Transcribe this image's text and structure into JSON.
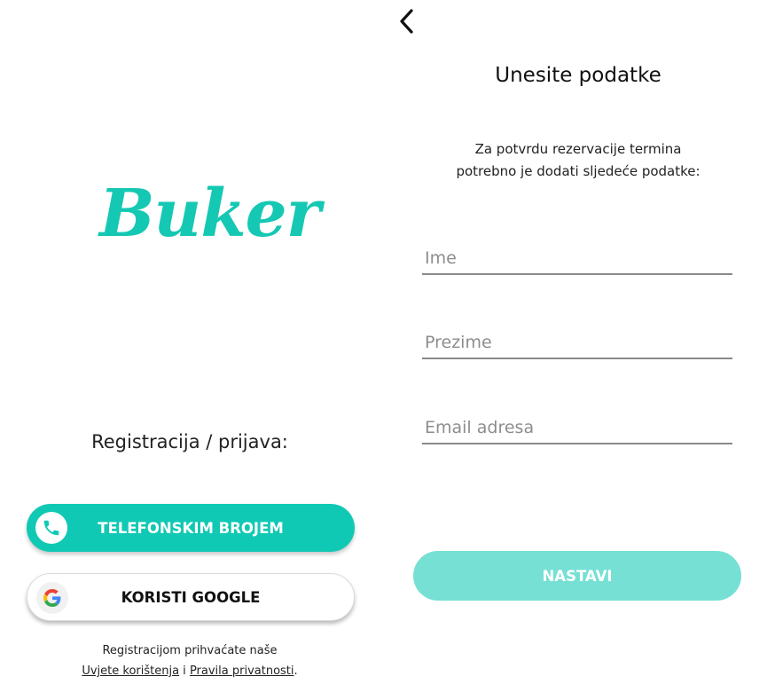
{
  "login": {
    "logo_text": "Buker",
    "registration_title": "Registracija / prijava:",
    "phone_button_label": "TELEFONSKIM BROJEM",
    "google_button_label": "KORISTI GOOGLE",
    "terms_line1": "Registracijom prihvaćate naše",
    "terms_link": "Uvjete korištenja",
    "terms_and": " i ",
    "privacy_link": "Pravila privatnosti",
    "terms_end": "."
  },
  "form": {
    "title": "Unesite podatke",
    "subtitle_line1": "Za potvrdu rezervacije termina",
    "subtitle_line2": "potrebno je dodati sljedeće podatke:",
    "first_name_placeholder": "Ime",
    "last_name_placeholder": "Prezime",
    "email_placeholder": "Email adresa",
    "next_button_label": "NASTAVI"
  },
  "icons": {
    "back": "chevron-left-icon",
    "phone": "phone-icon",
    "google": "google-icon"
  },
  "colors": {
    "brand": "#15c8b3",
    "primary_button": "#10c9b4",
    "disabled_button": "#76e0d4"
  }
}
